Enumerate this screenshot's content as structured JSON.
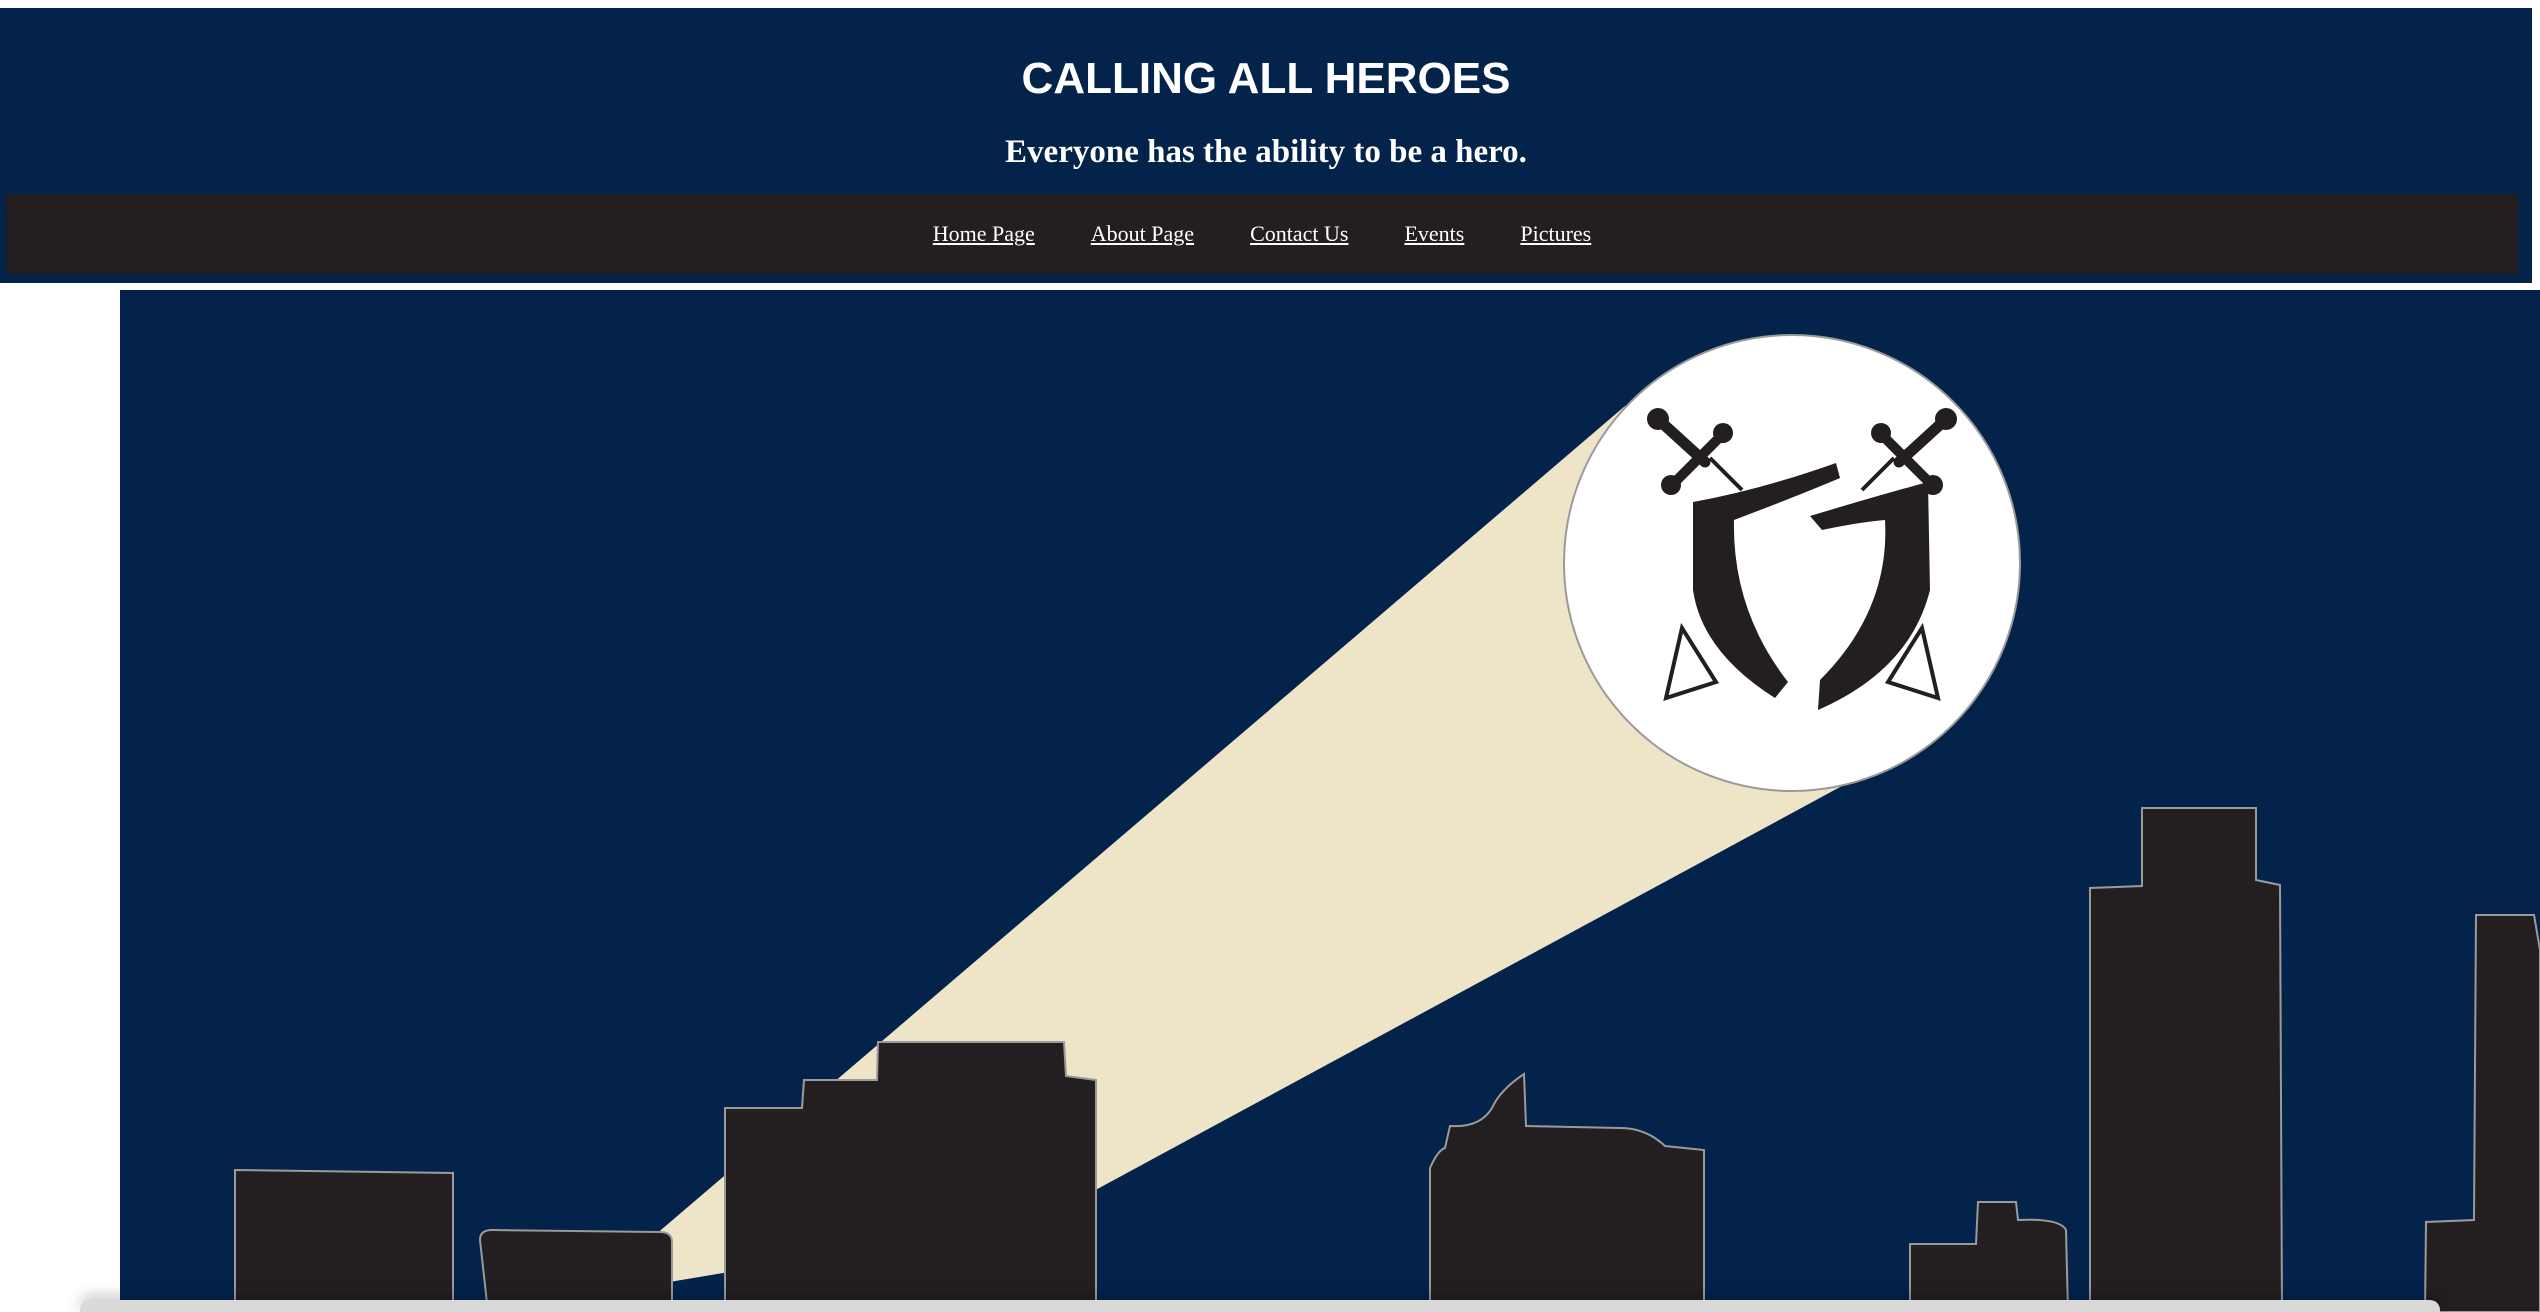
{
  "header": {
    "title": "CALLING ALL HEROES",
    "tagline": "Everyone has the ability to be a hero."
  },
  "nav": {
    "items": [
      {
        "label": "Home Page"
      },
      {
        "label": "About Page"
      },
      {
        "label": "Contact Us"
      },
      {
        "label": "Events"
      },
      {
        "label": "Pictures"
      }
    ]
  },
  "hero": {
    "emblem_icon": "crossed-swords-shield-icon"
  },
  "colors": {
    "header_bg": "#03234b",
    "nav_bg": "#231f20",
    "text": "#ffffff",
    "beam": "#eee4c8",
    "building": "#231f20",
    "spotlight": "#ffffff"
  }
}
